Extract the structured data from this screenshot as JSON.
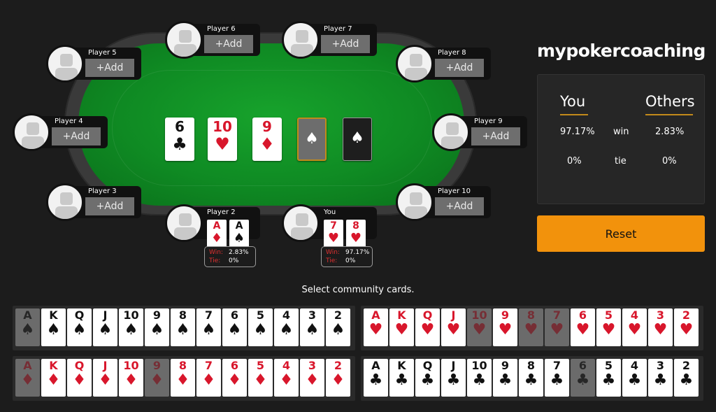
{
  "table": {
    "community_cards": [
      {
        "rank": "6",
        "suit": "♣",
        "color": "black"
      },
      {
        "rank": "10",
        "suit": "♥",
        "color": "red"
      },
      {
        "rank": "9",
        "suit": "♦",
        "color": "red"
      },
      {
        "rank": "",
        "suit": "spade-logo",
        "state": "empty-selected"
      },
      {
        "rank": "",
        "suit": "spade-logo",
        "state": "empty"
      }
    ],
    "seats": {
      "player5": {
        "name": "Player 5",
        "add_label": "+Add"
      },
      "player6": {
        "name": "Player 6",
        "add_label": "+Add"
      },
      "player7": {
        "name": "Player 7",
        "add_label": "+Add"
      },
      "player8": {
        "name": "Player 8",
        "add_label": "+Add"
      },
      "player4": {
        "name": "Player 4",
        "add_label": "+Add"
      },
      "player9": {
        "name": "Player 9",
        "add_label": "+Add"
      },
      "player3": {
        "name": "Player 3",
        "add_label": "+Add"
      },
      "player10": {
        "name": "Player 10",
        "add_label": "+Add"
      },
      "player2": {
        "name": "Player 2",
        "cards": [
          {
            "rank": "A",
            "suit": "♦"
          },
          {
            "rank": "A",
            "suit": "♠"
          }
        ],
        "win_label": "Win:",
        "win": "2.83%",
        "tie_label": "Tie:",
        "tie": "0%"
      },
      "you": {
        "name": "You",
        "cards": [
          {
            "rank": "7",
            "suit": "♥"
          },
          {
            "rank": "8",
            "suit": "♥"
          }
        ],
        "win_label": "Win:",
        "win": "97.17%",
        "tie_label": "Tie:",
        "tie": "0%"
      }
    }
  },
  "brand": {
    "text": "mypokercoaching"
  },
  "odds_panel": {
    "you_header": "You",
    "others_header": "Others",
    "win_label": "win",
    "tie_label": "tie",
    "you_win": "97.17%",
    "others_win": "2.83%",
    "you_tie": "0%",
    "others_tie": "0%"
  },
  "reset_label": "Reset",
  "prompt": "Select community cards.",
  "deck": {
    "spades": {
      "symbol": "♠",
      "color": "black",
      "ranks": [
        "A",
        "K",
        "Q",
        "J",
        "10",
        "9",
        "8",
        "7",
        "6",
        "5",
        "4",
        "3",
        "2"
      ],
      "used": [
        "A"
      ]
    },
    "hearts": {
      "symbol": "♥",
      "color": "red",
      "ranks": [
        "A",
        "K",
        "Q",
        "J",
        "10",
        "9",
        "8",
        "7",
        "6",
        "5",
        "4",
        "3",
        "2"
      ],
      "used": [
        "10",
        "8",
        "7"
      ]
    },
    "diamonds": {
      "symbol": "♦",
      "color": "red",
      "ranks": [
        "A",
        "K",
        "Q",
        "J",
        "10",
        "9",
        "8",
        "7",
        "6",
        "5",
        "4",
        "3",
        "2"
      ],
      "used": [
        "A",
        "9"
      ]
    },
    "clubs": {
      "symbol": "♣",
      "color": "black",
      "ranks": [
        "A",
        "K",
        "Q",
        "J",
        "10",
        "9",
        "8",
        "7",
        "6",
        "5",
        "4",
        "3",
        "2"
      ],
      "used": [
        "6"
      ]
    }
  },
  "colors": {
    "accent": "#f2920c",
    "felt": "#0f8a23",
    "red": "#d8162b",
    "gold": "#c28a1b"
  }
}
